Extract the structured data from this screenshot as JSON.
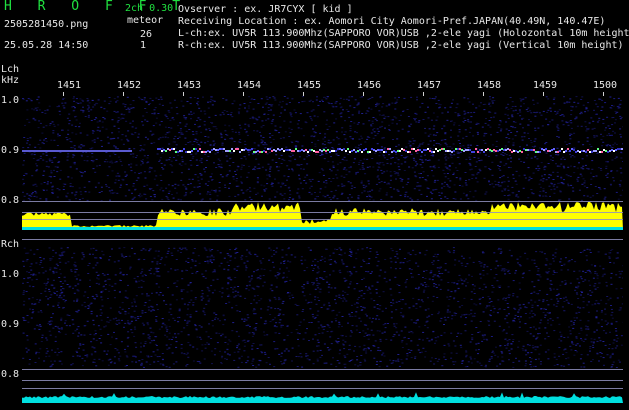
{
  "header": {
    "logo": "H R O F F T",
    "mode": "2ch 0.30",
    "meteor_label": "meteor",
    "lch_count": "26",
    "rch_count": "1",
    "filename": "2505281450.png",
    "datetime": "25.05.28 14:50",
    "observer": "Ovserver              : ex. JR7CYX [ kid ]",
    "location": "Receiving Location : ex. Aomori City Aomori-Pref.JAPAN(40.49N, 140.47E)",
    "lch_info": "L-ch:ex. UV5R 113.900Mhz(SAPPORO VOR)USB ,2-ele yagi (Holozontal 10m height",
    "rch_info": "R-ch:ex. UV5R 113.900Mhz(SAPPORO VOR)USB ,2-ele yagi (Vertical 10m height)"
  },
  "axis": {
    "lch_label": "Lch",
    "unit": "kHz",
    "rch_label": "Rch",
    "time_ticks": [
      "1451",
      "1452",
      "1453",
      "1454",
      "1455",
      "1456",
      "1457",
      "1458",
      "1459",
      "1500"
    ],
    "lch_freq": [
      "1.0",
      "0.9",
      "0.8"
    ],
    "rch_freq": [
      "1.0",
      "0.9",
      "0.8"
    ]
  },
  "colors": {
    "logo": "#20e040",
    "signal_trace": "#ffff00",
    "noise_trace": "#00e0e0",
    "background": "#000000"
  }
}
